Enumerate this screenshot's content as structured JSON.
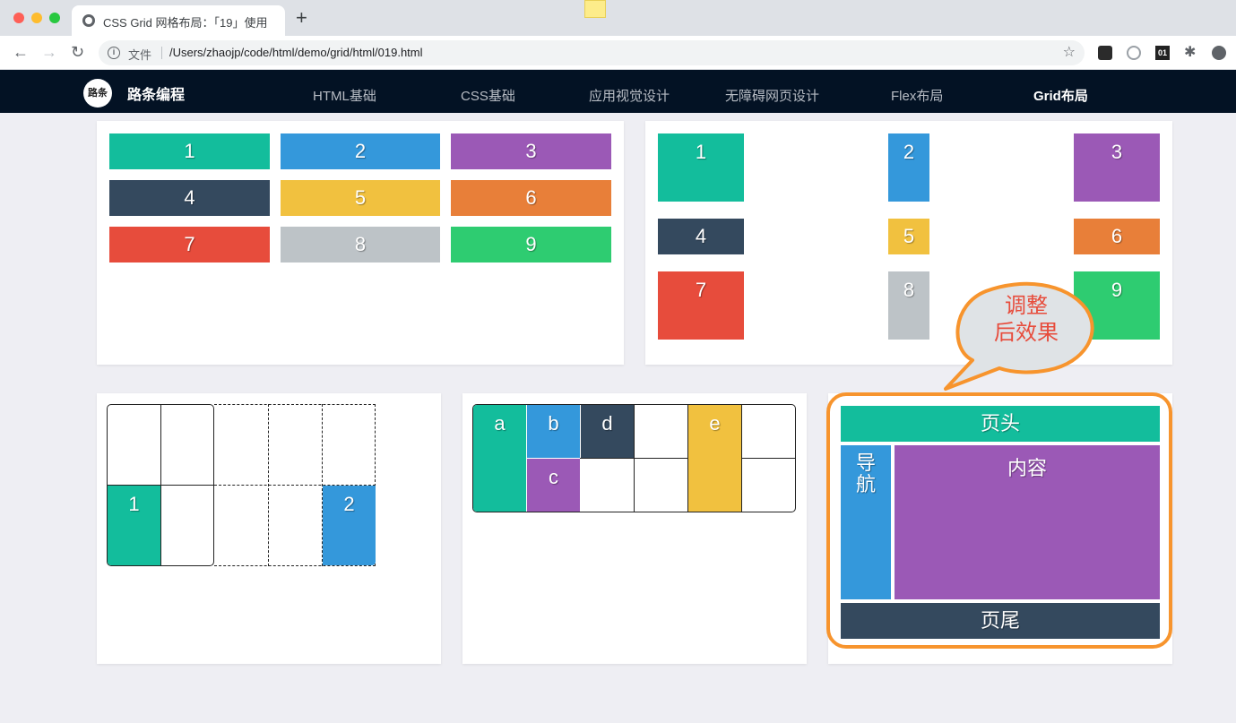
{
  "browser": {
    "tab_title": "CSS Grid 网格布局：「19」使用",
    "new_tab": "+",
    "security_label": "文件",
    "url": "/Users/zhaojp/code/html/demo/grid/html/019.html",
    "back_glyph": "←",
    "forward_glyph": "→",
    "reload_glyph": "↻",
    "star_glyph": "☆",
    "info_glyph": "i",
    "ext_label": "01",
    "puzzle_glyph": "✱"
  },
  "site": {
    "logo_text": "路条",
    "brand": "路条编程",
    "nav": [
      {
        "label": "HTML基础"
      },
      {
        "label": "CSS基础"
      },
      {
        "label": "应用视觉设计"
      },
      {
        "label": "无障碍网页设计"
      },
      {
        "label": "Flex布局"
      },
      {
        "label": "Grid布局",
        "active": true
      }
    ]
  },
  "panel1": {
    "items": [
      "1",
      "2",
      "3",
      "4",
      "5",
      "6",
      "7",
      "8",
      "9"
    ]
  },
  "panel2": {
    "items": [
      "1",
      "2",
      "3",
      "4",
      "5",
      "6",
      "7",
      "8",
      "9"
    ]
  },
  "panel3": {
    "items": [
      "1",
      "2"
    ]
  },
  "panel4": {
    "items": [
      "a",
      "b",
      "d",
      "e",
      "c"
    ]
  },
  "panel5": {
    "header": "页头",
    "nav": "导\n航",
    "content": "内容",
    "footer": "页尾"
  },
  "callout": {
    "line1": "调整",
    "line2": "后效果"
  },
  "colors": {
    "teal": "#13bd9c",
    "blue": "#3498db",
    "purple": "#9b59b6",
    "navy": "#34495e",
    "yellow": "#f1c13f",
    "orange": "#e87f39",
    "red": "#e74c3c",
    "gray": "#bdc3c7",
    "green": "#2ecc71",
    "highlight": "#f7942d"
  }
}
